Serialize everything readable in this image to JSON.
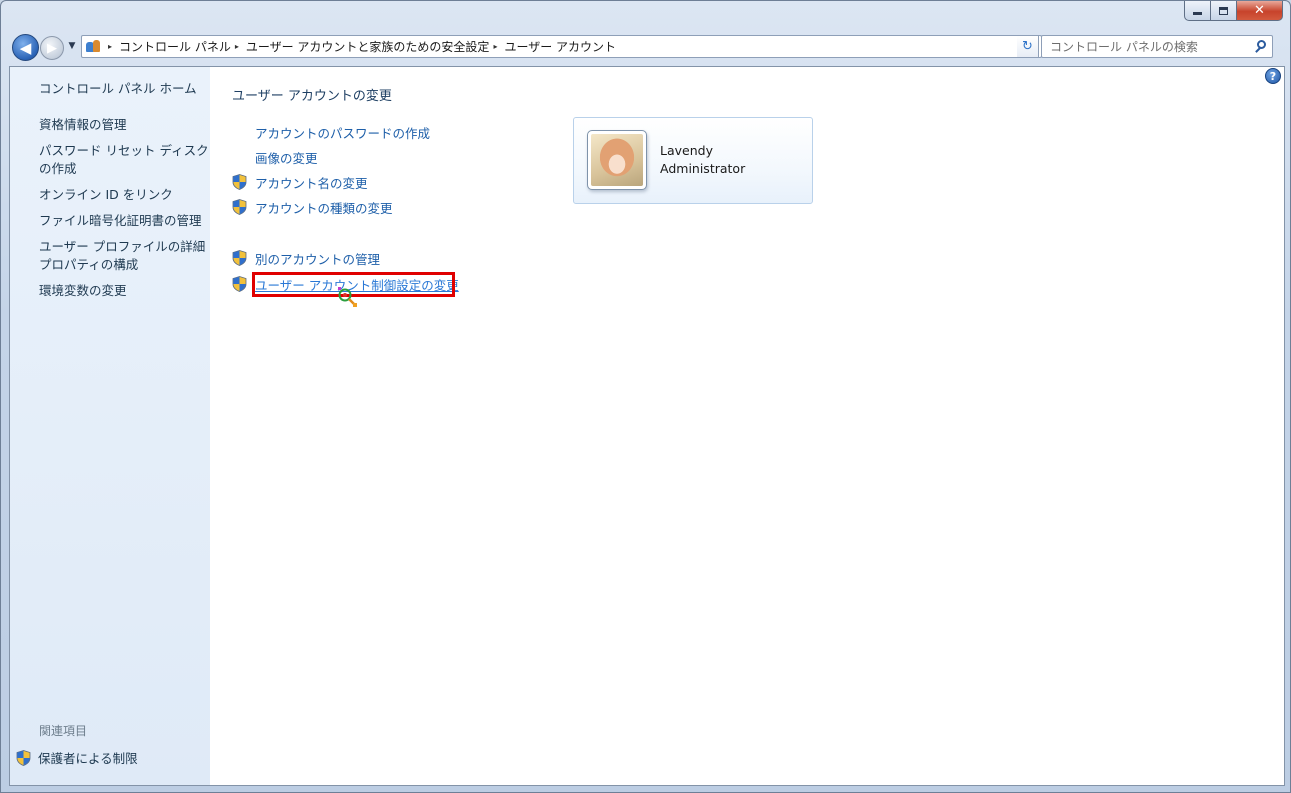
{
  "window": {
    "close_glyph": "✕",
    "restore_glyph": "",
    "minimize_glyph": ""
  },
  "navigation": {
    "back_glyph": "◀",
    "forward_glyph": "▶",
    "breadcrumbs": [
      "コントロール パネル",
      "ユーザー アカウントと家族のための安全設定",
      "ユーザー アカウント"
    ],
    "crumb_separator": "▸",
    "search_placeholder": "コントロール パネルの検索"
  },
  "sidebar": {
    "home": "コントロール パネル ホーム",
    "items": [
      "資格情報の管理",
      "パスワード リセット ディスク\nの作成",
      "オンライン ID をリンク",
      "ファイル暗号化証明書の管理",
      "ユーザー プロファイルの詳細\nプロパティの構成",
      "環境変数の変更"
    ],
    "related_heading": "関連項目",
    "related_item": "保護者による制限"
  },
  "main": {
    "title": "ユーザー アカウントの変更",
    "tasks": [
      {
        "label": "アカウントのパスワードの作成",
        "shield": false
      },
      {
        "label": "画像の変更",
        "shield": false
      },
      {
        "label": "アカウント名の変更",
        "shield": true
      },
      {
        "label": "アカウントの種類の変更",
        "shield": true
      }
    ],
    "other_tasks": [
      {
        "label": "別のアカウントの管理",
        "shield": true
      },
      {
        "label": "ユーザー アカウント制御設定の変更",
        "shield": true,
        "highlighted": true
      }
    ]
  },
  "user": {
    "name": "Lavendy",
    "role": "Administrator"
  },
  "help_glyph": "?",
  "colors": {
    "link": "#1e5fa9",
    "highlight_border": "#e00000",
    "sidebar_bg": "#e4eef9"
  }
}
